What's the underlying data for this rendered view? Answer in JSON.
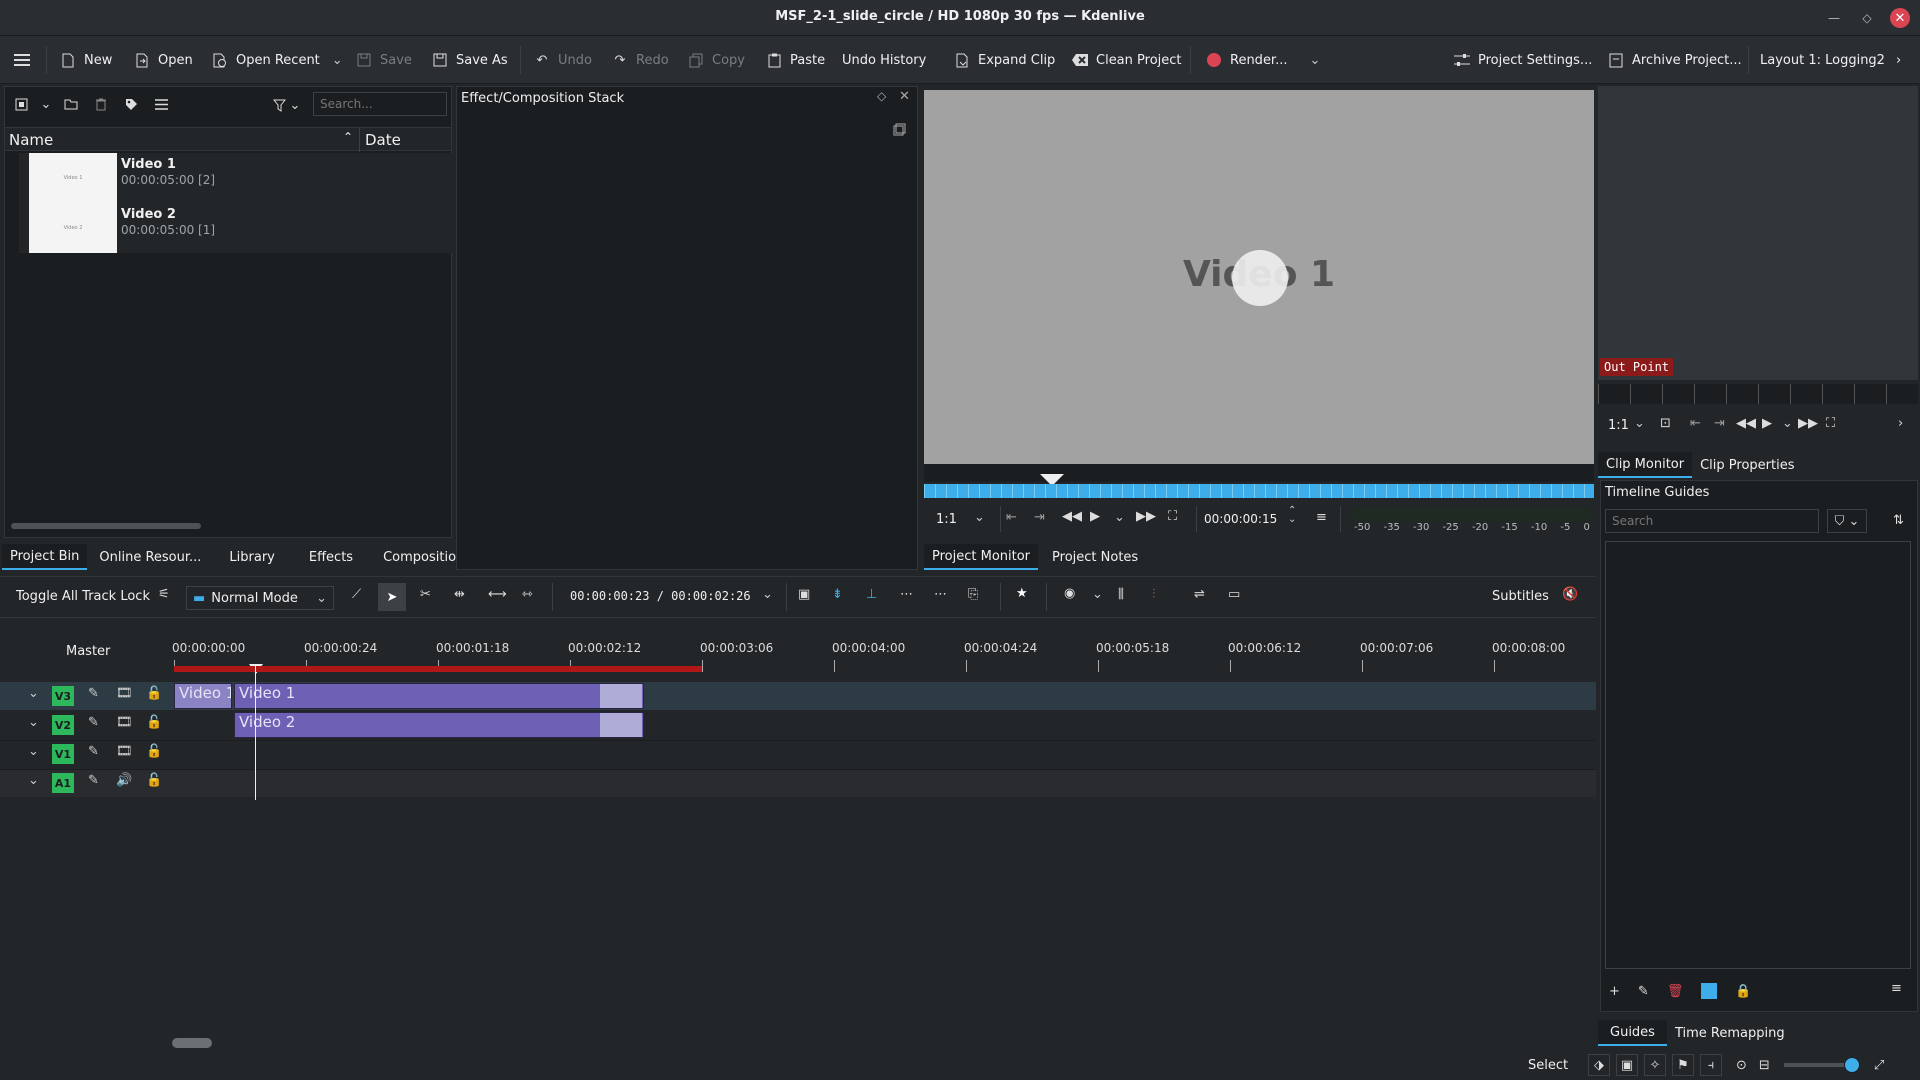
{
  "window": {
    "title": "MSF_2-1_slide_circle / HD 1080p 30 fps — Kdenlive"
  },
  "toolbar": {
    "new": "New",
    "open": "Open",
    "open_recent": "Open Recent",
    "save": "Save",
    "save_as": "Save As",
    "undo": "Undo",
    "redo": "Redo",
    "copy": "Copy",
    "paste": "Paste",
    "undo_history": "Undo History",
    "expand_clip": "Expand Clip",
    "clean_project": "Clean Project",
    "render": "Render...",
    "project_settings": "Project Settings...",
    "archive_project": "Archive Project...",
    "layout": "Layout 1: Logging2"
  },
  "bin": {
    "search_placeholder": "Search...",
    "col_name": "Name",
    "col_date": "Date",
    "items": [
      {
        "name": "Video 1",
        "duration": "00:00:05:00 [2]",
        "thumb_text": "Video 1"
      },
      {
        "name": "Video 2",
        "duration": "00:00:05:00 [1]",
        "thumb_text": "Video 2"
      }
    ],
    "tabs": [
      "Project Bin",
      "Online Resour...",
      "Library",
      "Effects",
      "Compositio..."
    ]
  },
  "effect_stack": {
    "title": "Effect/Composition Stack"
  },
  "project_monitor": {
    "overlay_text": "Video 1",
    "zoom": "1:1",
    "timecode": "00:00:00:15",
    "meter_ticks": [
      "-50",
      "-35",
      "-30",
      "-25",
      "-20",
      "-15",
      "-10",
      "-5",
      "0"
    ],
    "tabs": [
      "Project Monitor",
      "Project Notes"
    ]
  },
  "clip_monitor": {
    "marker_label": "Out Point",
    "zoom": "1:1",
    "tabs": [
      "Clip Monitor",
      "Clip Properties"
    ]
  },
  "guides": {
    "title": "Timeline Guides",
    "search_placeholder": "Search",
    "tabs": [
      "Guides",
      "Time Remapping"
    ]
  },
  "timeline": {
    "toggle_lock": "Toggle All Track Lock",
    "mode": "Normal Mode",
    "timecode": "00:00:00:23 / 00:00:02:26",
    "subtitles": "Subtitles",
    "master": "Master",
    "ruler": [
      "00:00:00:00",
      "00:00:00:24",
      "00:00:01:18",
      "00:00:02:12",
      "00:00:03:06",
      "00:00:04:00",
      "00:00:04:24",
      "00:00:05:18",
      "00:00:06:12",
      "00:00:07:06",
      "00:00:08:00"
    ],
    "tracks": [
      {
        "label": "V3",
        "type": "video"
      },
      {
        "label": "V2",
        "type": "video"
      },
      {
        "label": "V1",
        "type": "video"
      },
      {
        "label": "A1",
        "type": "audio"
      }
    ],
    "clips": [
      {
        "label": "Video 1",
        "track": "V3"
      },
      {
        "label": "Video 1",
        "track": "V3"
      },
      {
        "label": "Video 2",
        "track": "V2"
      }
    ]
  },
  "statusbar": {
    "select": "Select"
  },
  "colors": {
    "accent": "#3daee9",
    "track_badge": "#2eb85c",
    "clip": "#6d60b5",
    "render": "#da4453"
  }
}
